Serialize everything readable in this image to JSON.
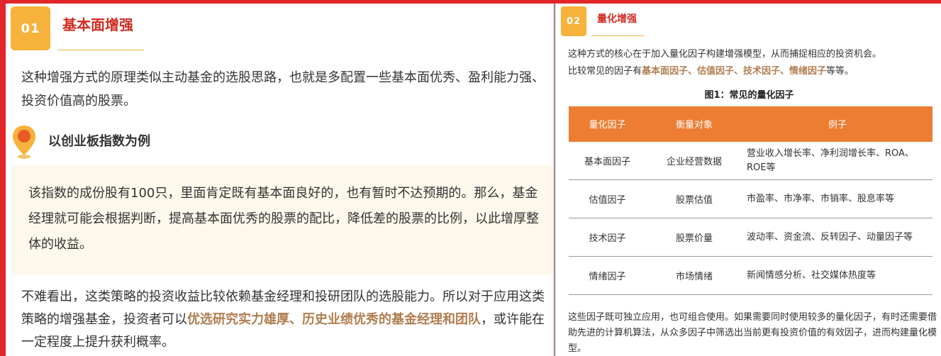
{
  "left": {
    "badge": "01",
    "title": "基本面增强",
    "intro": "这种增强方式的原理类似主动基金的选股思路，也就是多配置一些基本面优秀、盈利能力强、投资价值高的股票。",
    "example_title": "以创业板指数为例",
    "example_body": "该指数的成份股有100只，里面肯定既有基本面良好的，也有暂时不达预期的。那么，基金经理就可能会根据判断，提高基本面优秀的股票的配比，降低差的股票的比例，以此增厚整体的收益。",
    "conclusion_pre": "不难看出，这类策略的投资收益比较依赖基金经理和投研团队的选股能力。所以对于应用这类策略的增强基金，投资者可以",
    "conclusion_hl": "优选研究实力雄厚、历史业绩优秀的基金经理和团队",
    "conclusion_post": "，或许能在一定程度上提升获利概率。"
  },
  "right": {
    "badge": "02",
    "title": "量化增强",
    "intro_1": "这种方式的核心在于加入量化因子构建增强模型，从而捕捉相应的投资机会。",
    "intro_2_pre": "比较常见的因子有",
    "intro_2_hl": "基本面因子、估值因子、技术因子、情绪因子",
    "intro_2_post": "等等。",
    "figure_title": "图1：常见的量化因子",
    "table": {
      "headers": [
        "量化因子",
        "衡量对象",
        "例子"
      ],
      "rows": [
        [
          "基本面因子",
          "企业经营数据",
          "营业收入增长率、净利润增长率、ROA、ROE等"
        ],
        [
          "估值因子",
          "股票估值",
          "市盈率、市净率、市销率、股息率等"
        ],
        [
          "技术因子",
          "股票价量",
          "波动率、资金流、反转因子、动量因子等"
        ],
        [
          "情绪因子",
          "市场情绪",
          "新闻情感分析、社交媒体热度等"
        ]
      ]
    },
    "outro": "这些因子既可独立应用，也可组合使用。如果需要同时使用较多的量化因子，有时还需要借助先进的计算机算法，从众多因子中筛选出当前更有投资价值的有效因子，进而构建量化模型。"
  },
  "colors": {
    "frame": "#e3262a",
    "badge": "#f6b23a",
    "title_red": "#d12b1f",
    "highlight": "#b07d4f",
    "table_header": "#ec7d32",
    "quote_bg": "#fdf8ec",
    "divider": "#9fdde6"
  },
  "icons": {
    "location_pin": "location-pin-icon"
  }
}
